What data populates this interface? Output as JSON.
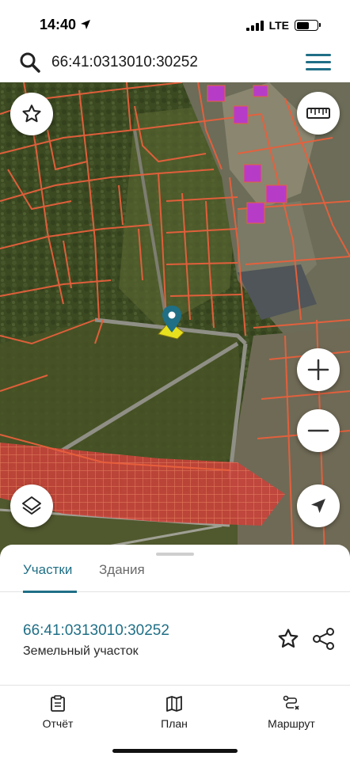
{
  "status_bar": {
    "time": "14:40",
    "network": "LTE",
    "battery_level": 0.6
  },
  "search": {
    "query": "66:41:0313010:30252",
    "icons": {
      "left": "search-icon",
      "right": "menu-icon"
    }
  },
  "map": {
    "buttons": [
      {
        "name": "favorites-button",
        "icon": "star-icon"
      },
      {
        "name": "ruler-button",
        "icon": "ruler-icon"
      },
      {
        "name": "zoom-in-button",
        "icon": "plus-icon"
      },
      {
        "name": "zoom-out-button",
        "icon": "minus-icon"
      },
      {
        "name": "layers-button",
        "icon": "layers-icon"
      },
      {
        "name": "locate-button",
        "icon": "navigation-arrow-icon"
      }
    ],
    "colors": {
      "parcel_border": "#e8603c",
      "selected_parcel": "#e6e01e",
      "marker": "#1f6f86",
      "building_highlight": "#b63cc8"
    }
  },
  "sheet": {
    "tabs": [
      {
        "label": "Участки",
        "active": true
      },
      {
        "label": "Здания",
        "active": false
      }
    ],
    "parcel": {
      "cadastral_number": "66:41:0313010:30252",
      "type": "Земельный участок"
    },
    "accent_color": "#1f6f86"
  },
  "bottom_nav": {
    "items": [
      {
        "label": "Отчёт",
        "icon": "report-icon"
      },
      {
        "label": "План",
        "icon": "map-plan-icon"
      },
      {
        "label": "Маршрут",
        "icon": "route-icon"
      }
    ]
  }
}
